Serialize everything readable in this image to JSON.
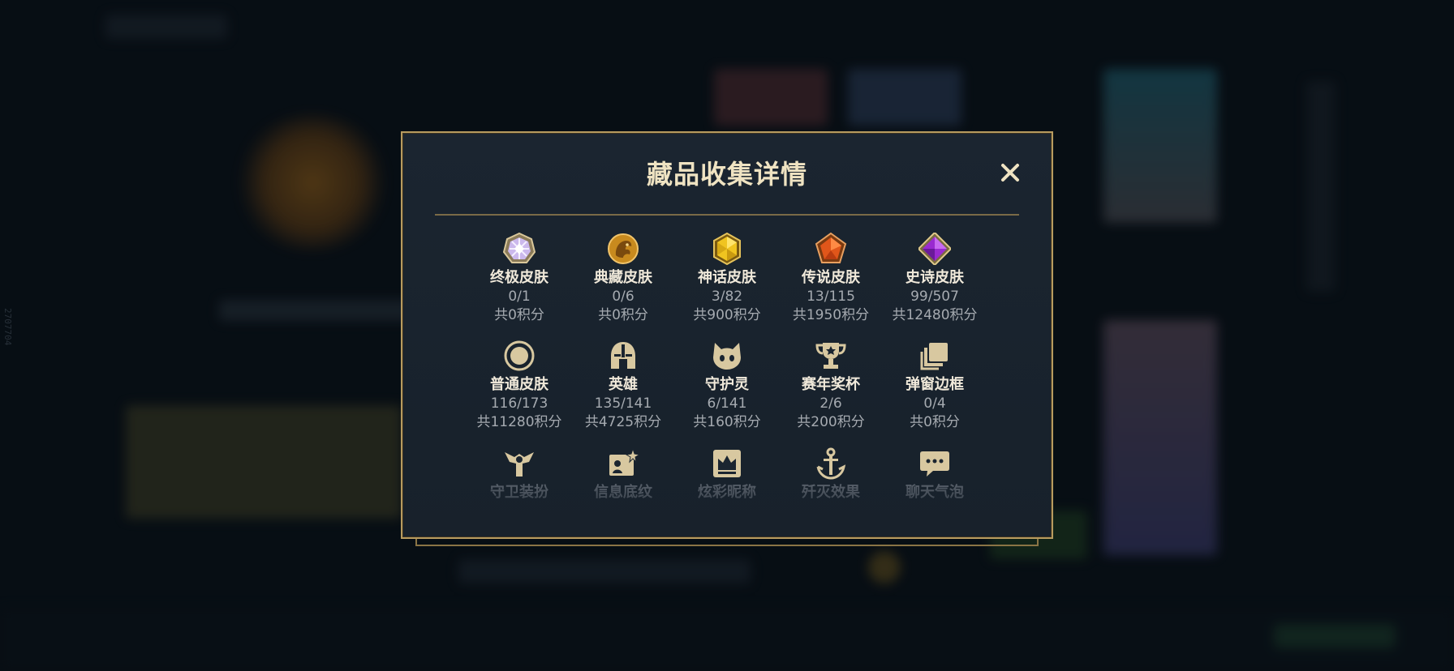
{
  "background": {
    "side_text": "2707704"
  },
  "modal": {
    "title": "藏品收集详情",
    "close_label": "✕",
    "rows": [
      [
        {
          "icon": "ultimate-skin-icon",
          "name": "终极皮肤",
          "count": "0/1",
          "points": "共0积分"
        },
        {
          "icon": "collection-skin-icon",
          "name": "典藏皮肤",
          "count": "0/6",
          "points": "共0积分"
        },
        {
          "icon": "mythic-skin-icon",
          "name": "神话皮肤",
          "count": "3/82",
          "points": "共900积分"
        },
        {
          "icon": "legendary-skin-icon",
          "name": "传说皮肤",
          "count": "13/115",
          "points": "共1950积分"
        },
        {
          "icon": "epic-skin-icon",
          "name": "史诗皮肤",
          "count": "99/507",
          "points": "共12480积分"
        }
      ],
      [
        {
          "icon": "normal-skin-icon",
          "name": "普通皮肤",
          "count": "116/173",
          "points": "共11280积分"
        },
        {
          "icon": "champion-helmet-icon",
          "name": "英雄",
          "count": "135/141",
          "points": "共4725积分"
        },
        {
          "icon": "guardian-icon",
          "name": "守护灵",
          "count": "6/141",
          "points": "共160积分"
        },
        {
          "icon": "season-trophy-icon",
          "name": "赛年奖杯",
          "count": "2/6",
          "points": "共200积分"
        },
        {
          "icon": "popup-frame-icon",
          "name": "弹窗边框",
          "count": "0/4",
          "points": "共0积分"
        }
      ],
      [
        {
          "icon": "ward-skin-icon",
          "name": "守卫装扮"
        },
        {
          "icon": "info-card-icon",
          "name": "信息底纹"
        },
        {
          "icon": "colorful-nickname-icon",
          "name": "炫彩昵称"
        },
        {
          "icon": "finisher-effect-icon",
          "name": "歼灭效果"
        },
        {
          "icon": "chat-bubble-icon",
          "name": "聊天气泡"
        }
      ]
    ]
  },
  "colors": {
    "gold_border": "#b79b5f",
    "title_text": "#efe3c2",
    "icon_gold": "#d8c8a0"
  }
}
